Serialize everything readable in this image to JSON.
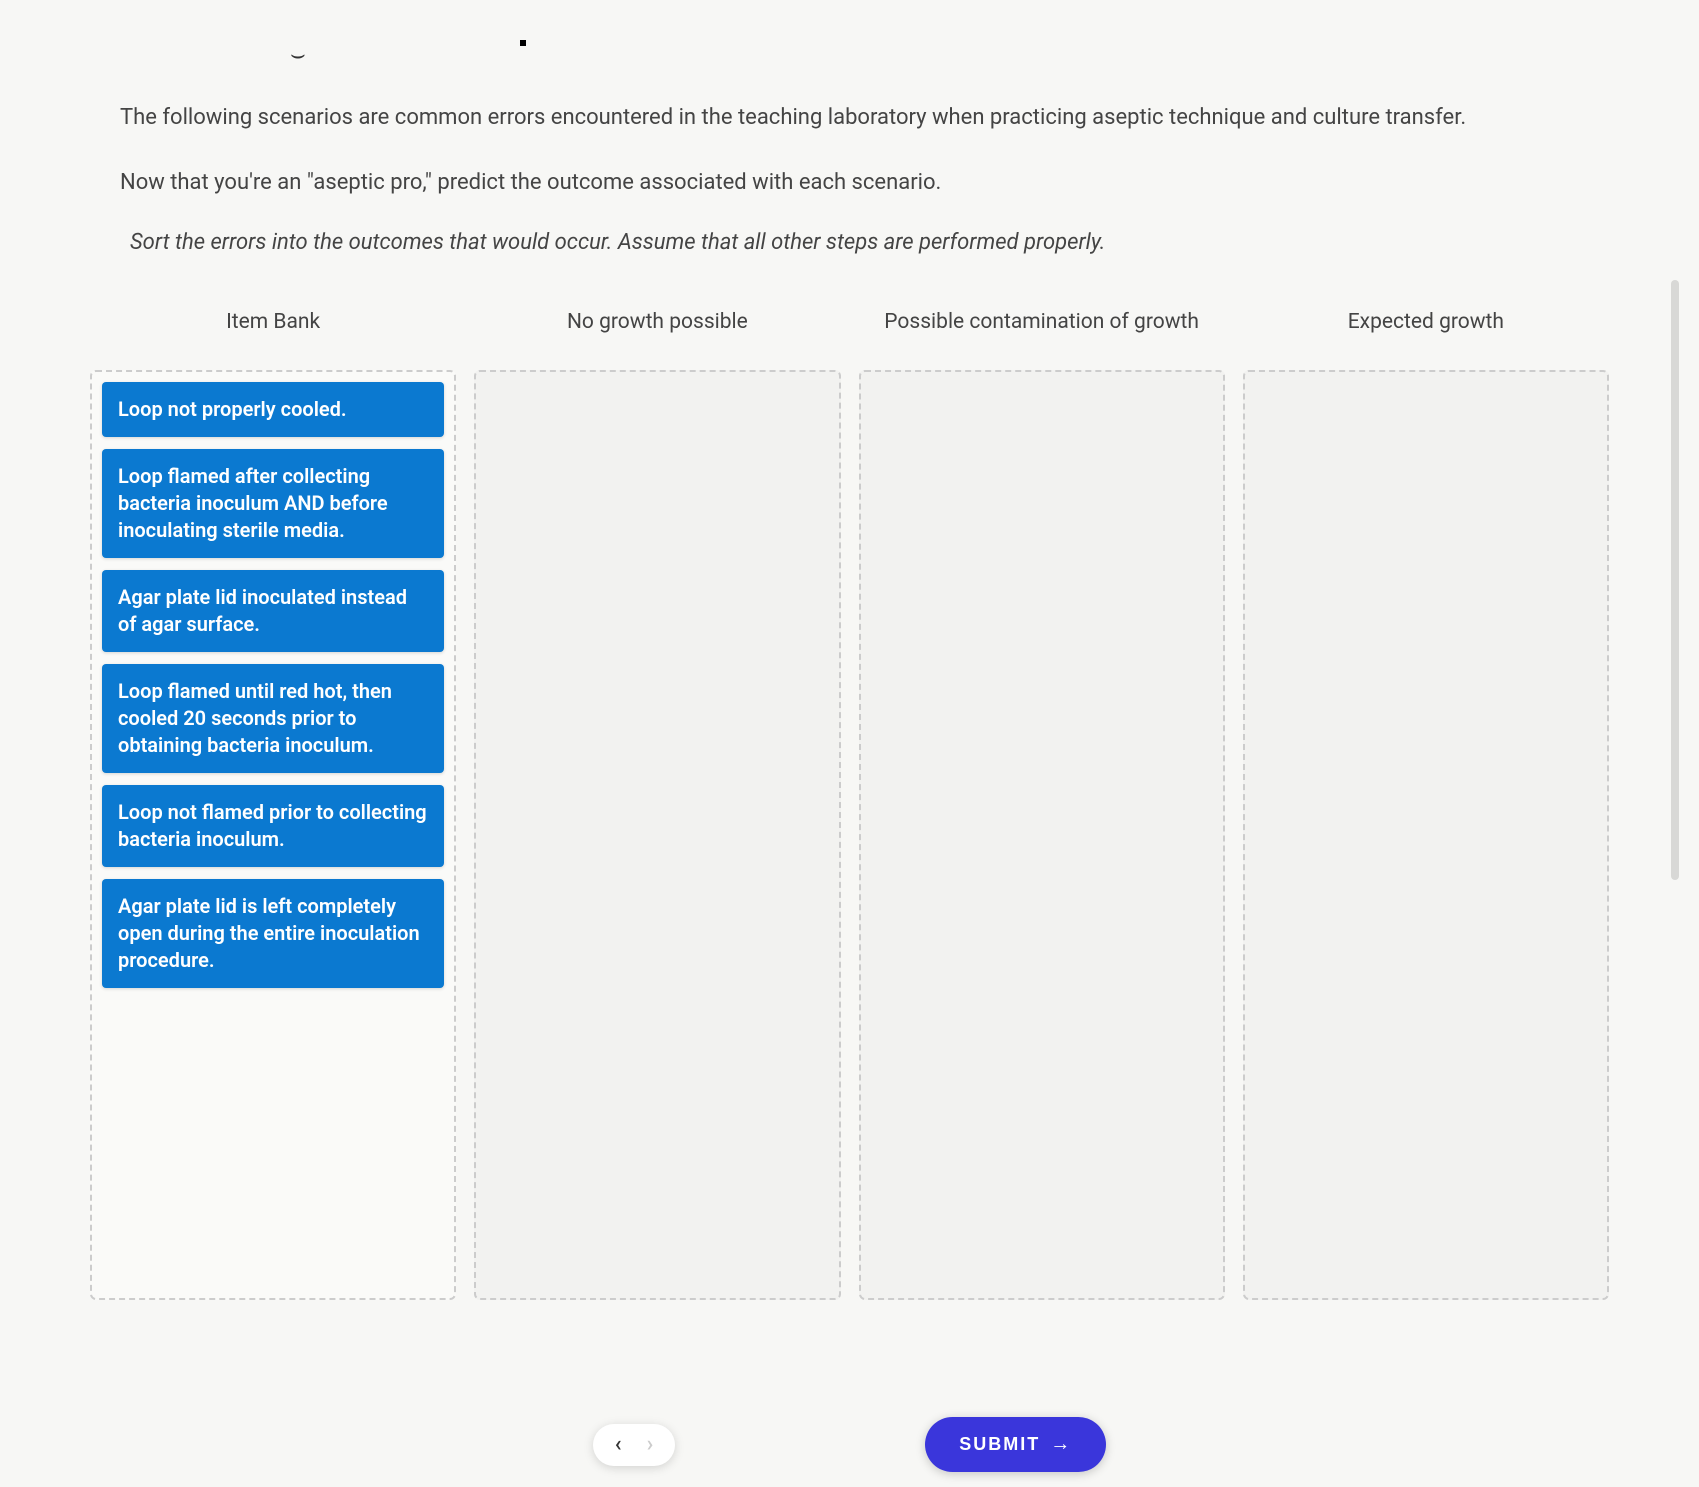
{
  "intro": {
    "paragraph1": "The following scenarios are common errors encountered in the teaching laboratory when practicing aseptic technique and culture transfer.",
    "paragraph2": "Now that you're an \"aseptic pro,\" predict the outcome associated with each scenario."
  },
  "instruction": "Sort the errors into the outcomes that would occur. Assume that all other steps are performed properly.",
  "columns": {
    "bank": {
      "header": "Item Bank"
    },
    "no_growth": {
      "header": "No growth possible"
    },
    "contamination": {
      "header": "Possible contamination of growth"
    },
    "expected": {
      "header": "Expected growth"
    }
  },
  "bank_items": [
    {
      "text": "Loop not properly cooled."
    },
    {
      "text": "Loop flamed after collecting bacteria inoculum AND before inoculating sterile media."
    },
    {
      "text": "Agar plate lid inoculated instead of agar surface."
    },
    {
      "text": "Loop flamed until red hot, then cooled 20 seconds prior to obtaining bacteria inoculum."
    },
    {
      "text": "Loop not flamed prior to collecting bacteria inoculum."
    },
    {
      "text": "Agar plate lid is left completely open during the entire inoculation procedure."
    }
  ],
  "controls": {
    "submit_label": "SUBMIT"
  }
}
